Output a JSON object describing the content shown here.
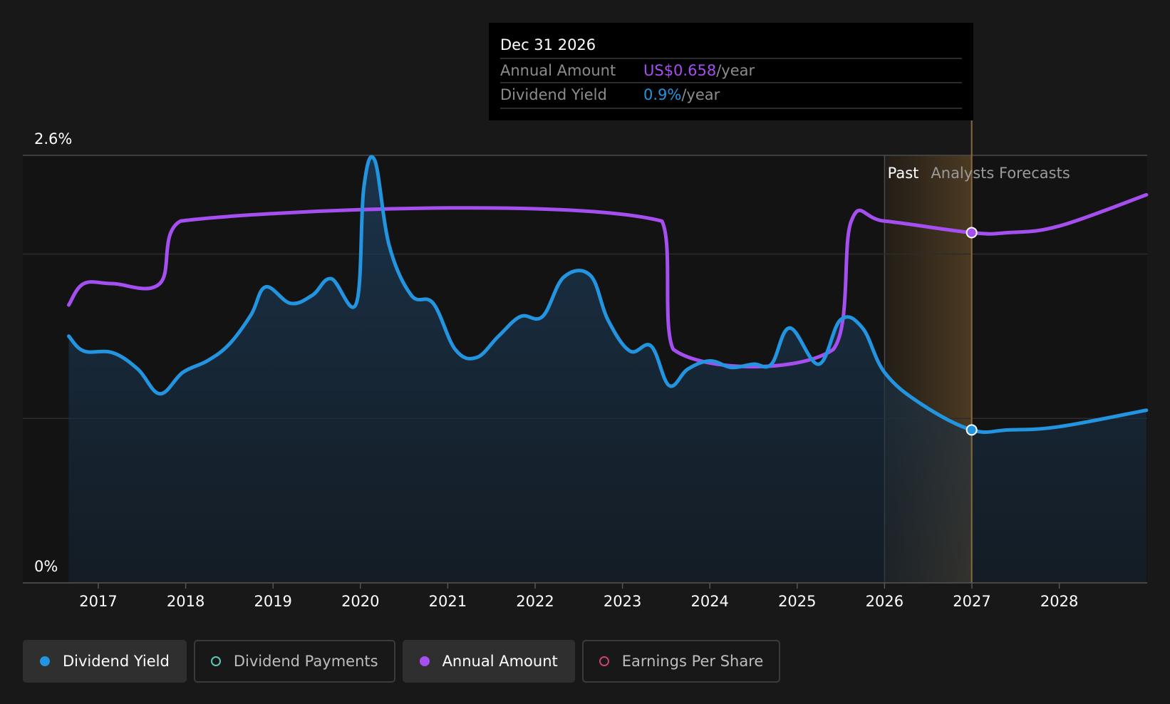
{
  "tooltip": {
    "date": "Dec 31 2026",
    "annual_label": "Annual Amount",
    "annual_value": "US$0.658",
    "annual_unit": "/year",
    "yield_label": "Dividend Yield",
    "yield_value": "0.9%",
    "yield_unit": "/year"
  },
  "regions": {
    "past_label": "Past",
    "forecast_label": "Analysts Forecasts"
  },
  "legend": [
    {
      "label": "Dividend Yield",
      "color": "#2394df",
      "active": true,
      "hollow": false
    },
    {
      "label": "Dividend Payments",
      "color": "#5bc8b4",
      "active": false,
      "hollow": true
    },
    {
      "label": "Annual Amount",
      "color": "#a54ff0",
      "active": true,
      "hollow": false
    },
    {
      "label": "Earnings Per Share",
      "color": "#c2447c",
      "active": false,
      "hollow": true
    }
  ],
  "colors": {
    "yield": "#2394df",
    "annual": "#a54ff0",
    "forecast_band": "#7a5a2f",
    "background": "#181818",
    "plot_background": "#131313"
  },
  "chart_data": {
    "type": "line",
    "x_axis": {
      "type": "date",
      "range": [
        "2016-03-01",
        "2028-12-31"
      ],
      "ticks": [
        "2017",
        "2018",
        "2019",
        "2020",
        "2021",
        "2022",
        "2023",
        "2024",
        "2025",
        "2026",
        "2027",
        "2028"
      ]
    },
    "y_axis": {
      "range": [
        0,
        2.6
      ],
      "unit": "%",
      "tick_labels": [
        "0%",
        "2.6%"
      ]
    },
    "past_forecast_divider": "2026-01-01",
    "selected_date": "2026-12-31",
    "series": [
      {
        "name": "Dividend Yield",
        "unit": "%",
        "fill": true,
        "points": [
          [
            "2016-08-30",
            1.5
          ],
          [
            "2016-11-01",
            1.41
          ],
          [
            "2017-03-01",
            1.4
          ],
          [
            "2017-06-15",
            1.3
          ],
          [
            "2017-09-15",
            1.15
          ],
          [
            "2017-12-20",
            1.28
          ],
          [
            "2018-04-01",
            1.35
          ],
          [
            "2018-07-01",
            1.45
          ],
          [
            "2018-10-01",
            1.63
          ],
          [
            "2018-12-01",
            1.8
          ],
          [
            "2019-03-15",
            1.7
          ],
          [
            "2019-06-15",
            1.75
          ],
          [
            "2019-09-01",
            1.85
          ],
          [
            "2019-12-15",
            1.7
          ],
          [
            "2020-01-15",
            2.4
          ],
          [
            "2020-03-01",
            2.57
          ],
          [
            "2020-05-01",
            2.05
          ],
          [
            "2020-08-01",
            1.75
          ],
          [
            "2020-11-01",
            1.7
          ],
          [
            "2021-02-01",
            1.42
          ],
          [
            "2021-05-01",
            1.37
          ],
          [
            "2021-08-01",
            1.5
          ],
          [
            "2021-11-01",
            1.62
          ],
          [
            "2022-02-01",
            1.62
          ],
          [
            "2022-05-01",
            1.86
          ],
          [
            "2022-08-20",
            1.87
          ],
          [
            "2022-11-01",
            1.6
          ],
          [
            "2023-02-01",
            1.41
          ],
          [
            "2023-05-01",
            1.44
          ],
          [
            "2023-07-15",
            1.2
          ],
          [
            "2023-10-01",
            1.3
          ],
          [
            "2024-01-01",
            1.35
          ],
          [
            "2024-04-01",
            1.31
          ],
          [
            "2024-07-01",
            1.33
          ],
          [
            "2024-09-15",
            1.33
          ],
          [
            "2024-12-01",
            1.55
          ],
          [
            "2025-04-01",
            1.33
          ],
          [
            "2025-07-01",
            1.6
          ],
          [
            "2025-10-01",
            1.55
          ],
          [
            "2026-01-01",
            1.28
          ],
          [
            "2026-06-01",
            1.09
          ],
          [
            "2026-12-31",
            0.93
          ],
          [
            "2027-06-01",
            0.93
          ],
          [
            "2028-01-01",
            0.95
          ],
          [
            "2028-12-31",
            1.05
          ]
        ]
      },
      {
        "name": "Annual Amount",
        "fill": false,
        "points": [
          [
            "2016-08-30",
            1.69
          ],
          [
            "2016-11-01",
            1.82
          ],
          [
            "2017-03-01",
            1.82
          ],
          [
            "2017-09-15",
            1.82
          ],
          [
            "2017-12-10",
            2.2
          ],
          [
            "2023-06-15",
            2.2
          ],
          [
            "2023-08-01",
            1.42
          ],
          [
            "2025-06-01",
            1.42
          ],
          [
            "2025-08-15",
            2.2
          ],
          [
            "2026-01-01",
            2.2
          ],
          [
            "2026-12-31",
            2.13
          ],
          [
            "2027-06-01",
            2.13
          ],
          [
            "2028-01-01",
            2.17
          ],
          [
            "2028-12-31",
            2.36
          ]
        ]
      }
    ]
  }
}
